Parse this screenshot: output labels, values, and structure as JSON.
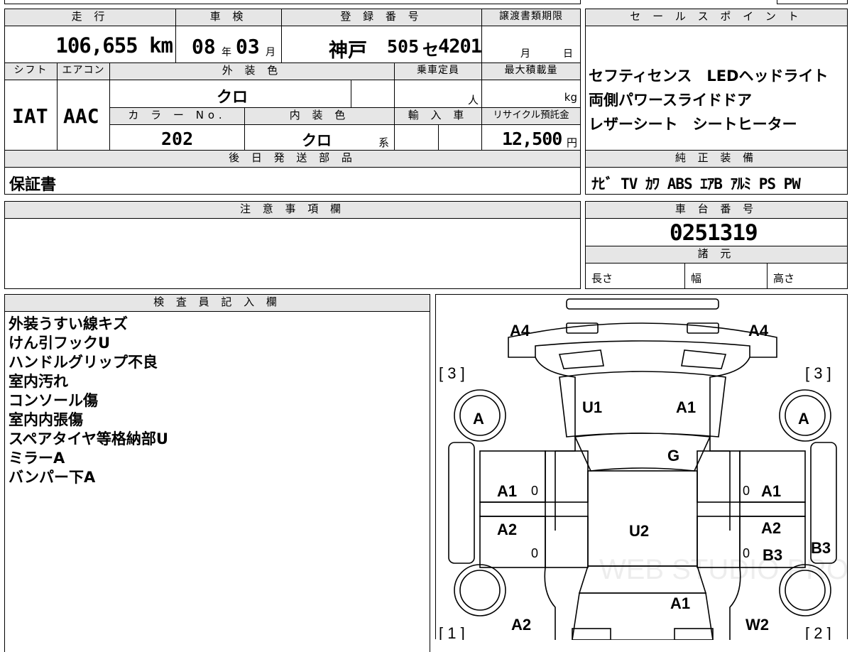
{
  "top": {
    "mileage_header": "走 行",
    "mileage_value": "106,655 km",
    "shaken_header": "車 検",
    "shaken_year": "08",
    "shaken_year_unit": "年",
    "shaken_month": "03",
    "shaken_month_unit": "月",
    "reg_header": "登 録 番 号",
    "reg_region": "神戸",
    "reg_class": "505",
    "reg_kana": "セ",
    "reg_number": "4201",
    "transfer_header": "譲渡書類期限",
    "transfer_month_unit": "月",
    "transfer_day_unit": "日"
  },
  "row2": {
    "shift_header": "シフト",
    "shift_value": "IAT",
    "ac_header": "エアコン",
    "ac_value": "AAC",
    "ext_color_header": "外 装 色",
    "ext_color_value": "クロ",
    "capacity_header": "乗車定員",
    "capacity_unit": "人",
    "load_header": "最大積載量",
    "load_unit": "kg",
    "color_no_header": "カ ラ ー No.",
    "color_no_value": "202",
    "int_color_header": "内 装 色",
    "int_color_value": "クロ",
    "int_color_suffix": "系",
    "import_header": "輸 入 車",
    "recycle_header": "リサイクル預託金",
    "recycle_value": "12,500",
    "recycle_unit": "円"
  },
  "parts": {
    "header": "後 日 発 送 部 品",
    "value": "保証書"
  },
  "sales": {
    "header": "セ ー ル ス ポ イ ン ト",
    "lines": [
      "セフティセンス　LEDヘッドライト",
      "両側パワースライドドア",
      "レザーシート　シートヒーター"
    ]
  },
  "equipment": {
    "header": "純 正 装 備",
    "value": "ﾅﾋﾞ TV ｶﾜ ABS ｴｱB ｱﾙﾐ PS PW"
  },
  "notes": {
    "header": "注 意 事 項 欄"
  },
  "chassis": {
    "header": "車 台 番 号",
    "value": "0251319",
    "spec_header": "諸 元",
    "length_label": "長さ",
    "width_label": "幅",
    "height_label": "高さ"
  },
  "inspector": {
    "header": "検 査 員 記 入 欄",
    "lines": [
      "外装うすい線キズ",
      "けん引フックU",
      "ハンドルグリップ不良",
      "室内汚れ",
      "コンソール傷",
      "室内内張傷",
      "スペアタイヤ等格納部U",
      "ミラーA",
      "バンパー下A"
    ]
  },
  "diagram": {
    "marks": {
      "a4_left": "A4",
      "a4_right": "A4",
      "num3_left": "[ 3 ]",
      "num3_right": "[ 3 ]",
      "tire_fl": "A",
      "tire_fr": "A",
      "u1": "U1",
      "a1_hood": "A1",
      "g": "G",
      "a1_left": "A1",
      "a1_right": "A1",
      "zero1": "0",
      "zero2": "0",
      "zero3": "0",
      "zero4": "0",
      "a2_left": "A2",
      "a2_right": "A2",
      "u2": "U2",
      "b3_door": "B3",
      "b3_side": "B3",
      "a1_rear": "A1",
      "a2_rear": "A2",
      "w2": "W2",
      "num1": "[ 1 ]",
      "num2": "[ 2 ]"
    },
    "watermark": "WEB STUDIO PRO"
  }
}
